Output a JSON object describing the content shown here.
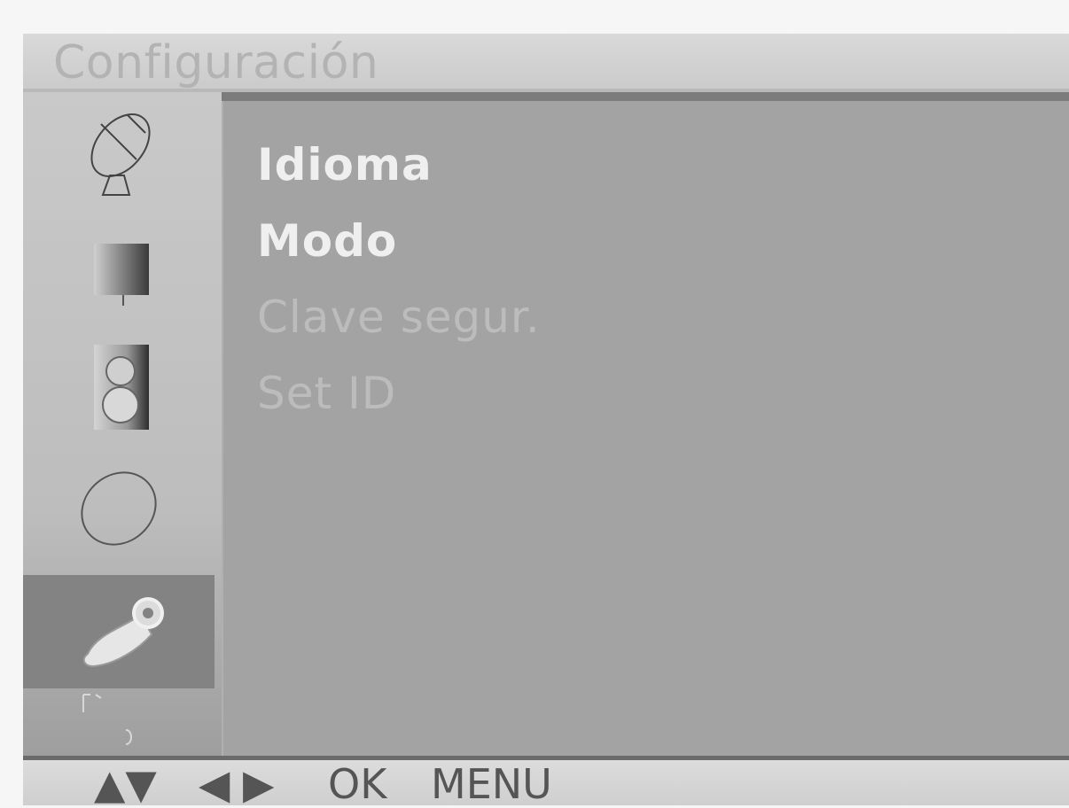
{
  "header": {
    "title": "Configuración"
  },
  "sidebar": {
    "items": [
      {
        "icon": "satellite-dish-icon",
        "active": false
      },
      {
        "icon": "picture-icon",
        "active": false
      },
      {
        "icon": "speaker-icon",
        "active": false
      },
      {
        "icon": "clock-icon",
        "active": false
      },
      {
        "icon": "setup-key-icon",
        "active": true
      }
    ]
  },
  "menu": {
    "items": [
      {
        "label": "Idioma",
        "enabled": true
      },
      {
        "label": "Modo",
        "enabled": true
      },
      {
        "label": "Clave segur.",
        "enabled": false
      },
      {
        "label": "Set ID",
        "enabled": false
      }
    ]
  },
  "footer": {
    "nav_updown": "▲▼",
    "nav_leftright": "◀ ▶",
    "ok_label": "OK",
    "menu_label": "MENU"
  },
  "colors": {
    "background": "#7c7c7c",
    "active_item": "#838383",
    "text_enabled": "#efefef",
    "text_disabled": "#bcbcbc"
  }
}
